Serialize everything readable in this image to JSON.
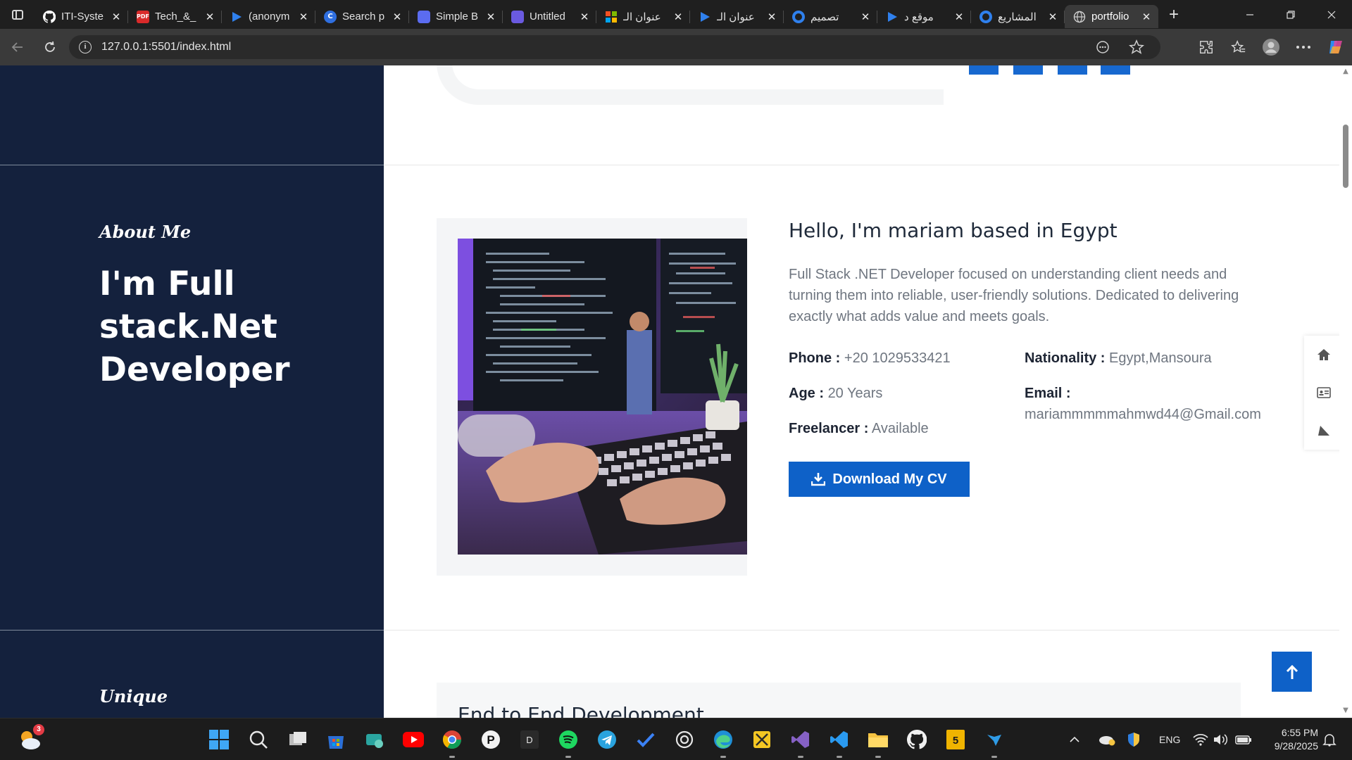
{
  "browser": {
    "tabs": [
      {
        "title": "ITI-Syste",
        "icon": "github-icon",
        "color": "#ffffff"
      },
      {
        "title": "Tech_&_",
        "icon": "pdf-icon",
        "color": "#d92a2a"
      },
      {
        "title": "(anonym",
        "icon": "play-icon",
        "color": "#2f80ed"
      },
      {
        "title": "Search p",
        "icon": "copilot-icon",
        "color": "#3b82f6"
      },
      {
        "title": "Simple B",
        "icon": "app-icon",
        "color": "#5b6cf0"
      },
      {
        "title": "Untitled",
        "icon": "editor-icon",
        "color": "#5b6cf0"
      },
      {
        "title": "عنوان الـ",
        "icon": "microsoft-icon",
        "color": "#f25022"
      },
      {
        "title": "عنوان الـ",
        "icon": "play-icon",
        "color": "#2f80ed"
      },
      {
        "title": "تصميم",
        "icon": "circle-icon",
        "color": "#2f80ed"
      },
      {
        "title": "موقع د",
        "icon": "play-icon",
        "color": "#2f80ed"
      },
      {
        "title": "المشاريع",
        "icon": "circle-icon",
        "color": "#2f80ed"
      },
      {
        "title": "portfolio",
        "icon": "globe-icon",
        "color": "#cfcfcf"
      }
    ],
    "active_tab_index": 11,
    "close_glyph": "✕",
    "new_tab_glyph": "+",
    "url": "127.0.0.1:5501/index.html"
  },
  "sidebar": {
    "about_eyebrow": "About Me",
    "about_title": "I'm Full stack.Net Developer",
    "unique_eyebrow": "Unique"
  },
  "about": {
    "heading": "Hello, I'm mariam based in Egypt",
    "bio": "Full Stack .NET Developer focused on understanding client needs and turning them into reliable, user-friendly solutions. Dedicated to delivering exactly what adds value and meets goals.",
    "phone_label": "Phone :",
    "phone_value": "+20 1029533421",
    "age_label": "Age :",
    "age_value": "20 Years",
    "freelancer_label": "Freelancer :",
    "freelancer_value": "Available",
    "nationality_label": "Nationality :",
    "nationality_value": "Egypt,Mansoura",
    "email_label": "Email :",
    "email_value": "mariammmmmahmwd44@Gmail.com",
    "cv_button": "Download My CV"
  },
  "services": {
    "first_title": "End to End Development"
  },
  "taskbar": {
    "weather_badge": "3",
    "language": "ENG",
    "time": "6:55 PM",
    "date": "9/28/2025"
  },
  "colors": {
    "sidebar_bg": "#14213d",
    "accent_blue": "#0e61c8",
    "heading": "#1f2a3a",
    "muted_text": "#6f7680"
  }
}
